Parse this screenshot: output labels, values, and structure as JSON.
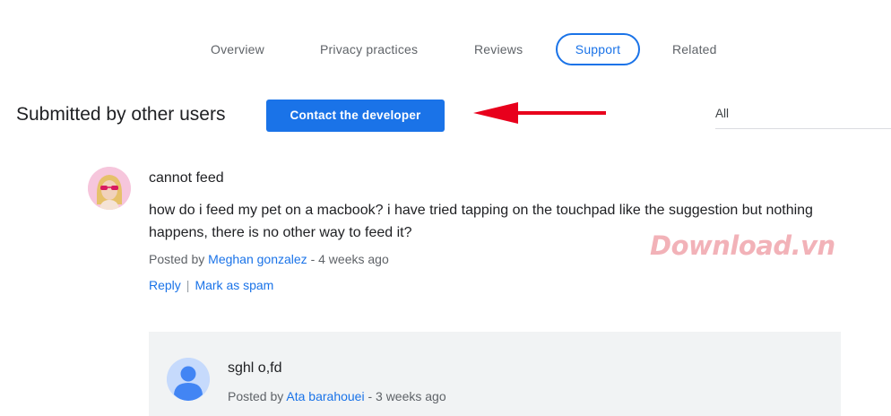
{
  "nav": {
    "tabs": [
      {
        "label": "Overview",
        "active": false
      },
      {
        "label": "Privacy practices",
        "active": false
      },
      {
        "label": "Reviews",
        "active": false
      },
      {
        "label": "Support",
        "active": true
      },
      {
        "label": "Related",
        "active": false
      }
    ]
  },
  "support": {
    "section_title": "Submitted by other users",
    "contact_button": "Contact the developer",
    "filter_value": "All"
  },
  "annotation": {
    "arrow_color": "#e8001c"
  },
  "review": {
    "title": "cannot feed",
    "body": "how do i feed my pet on a macbook? i have tried tapping on the touchpad like the suggestion but nothing happens, there is no other way to feed it?",
    "posted_by_prefix": "Posted by",
    "author": "Meghan gonzalez",
    "time": "- 4 weeks ago",
    "reply_label": "Reply",
    "separator": "|",
    "spam_label": "Mark as spam"
  },
  "reply": {
    "title": "sghl o,fd",
    "posted_by_prefix": "Posted by",
    "author": "Ata barahouei",
    "time": "- 3 weeks ago"
  },
  "watermark": {
    "text": "Download.vn"
  },
  "colors": {
    "accent": "#1a73e8",
    "reply_bg": "#f1f3f4",
    "default_avatar": "#8ab4f8"
  }
}
